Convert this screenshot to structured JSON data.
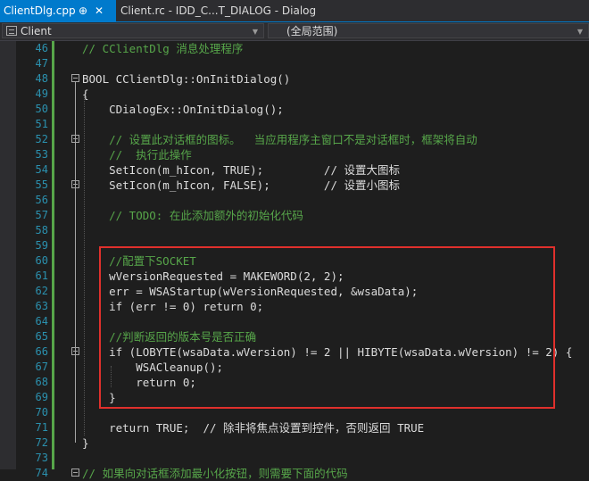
{
  "tabs": {
    "active_label": "ClientDlg.cpp",
    "pin_glyph": "⊕",
    "close_glyph": "✕",
    "inactive_label": "Client.rc - IDD_C...T_DIALOG - Dialog"
  },
  "navbar": {
    "project": "Client",
    "scope": "(全局范围)"
  },
  "lines": [
    {
      "n": "46",
      "t": "// CClientDlg 消息处理程序"
    },
    {
      "n": "47",
      "t": ""
    },
    {
      "n": "48",
      "t": "BOOL CClientDlg::OnInitDialog()"
    },
    {
      "n": "49",
      "t": "{"
    },
    {
      "n": "50",
      "t": "    CDialogEx::OnInitDialog();"
    },
    {
      "n": "51",
      "t": ""
    },
    {
      "n": "52",
      "t": "    // 设置此对话框的图标。  当应用程序主窗口不是对话框时，框架将自动"
    },
    {
      "n": "53",
      "t": "    //  执行此操作"
    },
    {
      "n": "54",
      "t": "    SetIcon(m_hIcon, TRUE);         // 设置大图标"
    },
    {
      "n": "55",
      "t": "    SetIcon(m_hIcon, FALSE);        // 设置小图标"
    },
    {
      "n": "56",
      "t": ""
    },
    {
      "n": "57",
      "t": "    // TODO: 在此添加额外的初始化代码"
    },
    {
      "n": "58",
      "t": ""
    },
    {
      "n": "59",
      "t": ""
    },
    {
      "n": "60",
      "t": "    //配置下SOCKET"
    },
    {
      "n": "61",
      "t": "    wVersionRequested = MAKEWORD(2, 2);"
    },
    {
      "n": "62",
      "t": "    err = WSAStartup(wVersionRequested, &wsaData);"
    },
    {
      "n": "63",
      "t": "    if (err != 0) return 0;"
    },
    {
      "n": "64",
      "t": ""
    },
    {
      "n": "65",
      "t": "    //判断返回的版本号是否正确"
    },
    {
      "n": "66",
      "t": "    if (LOBYTE(wsaData.wVersion) != 2 || HIBYTE(wsaData.wVersion) != 2) {"
    },
    {
      "n": "67",
      "t": "        WSACleanup();"
    },
    {
      "n": "68",
      "t": "        return 0;"
    },
    {
      "n": "69",
      "t": "    }"
    },
    {
      "n": "70",
      "t": ""
    },
    {
      "n": "71",
      "t": "    return TRUE;  // 除非将焦点设置到控件，否则返回 TRUE"
    },
    {
      "n": "72",
      "t": "}"
    },
    {
      "n": "73",
      "t": ""
    },
    {
      "n": "74",
      "t": "// 如果向对话框添加最小化按钮，则需要下面的代码"
    }
  ]
}
